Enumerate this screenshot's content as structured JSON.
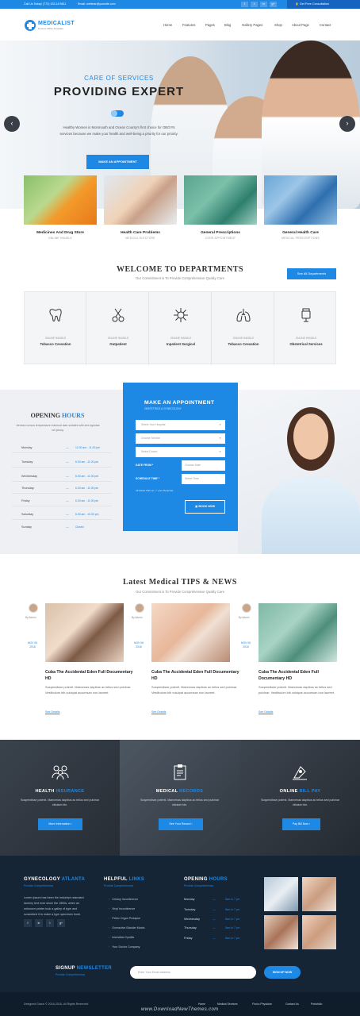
{
  "topbar": {
    "call": "Call Us Today! (772) 433-18 5611",
    "email": "Email: webinar@yoursite.com",
    "social": [
      "f",
      "t",
      "in",
      "g+"
    ],
    "consult": "Get Free Consultation"
  },
  "header": {
    "logo": "MEDICALIST",
    "tagline": "Doctors Office Template",
    "nav": [
      "Home",
      "Features",
      "Pages",
      "Blog",
      "Gallery Pages",
      "Shop",
      "About Page",
      "Contact"
    ]
  },
  "hero": {
    "eyebrow": "CARE OF SERVICES",
    "title": "PROVIDING EXPERT",
    "text": "Healthy Women is Monmouth and Ocean County's first choice for OBGYN services because we make your health and well-being a priority for our priority.",
    "button": "MAKE AN APPOINTMENT",
    "prev": "‹",
    "next": "›"
  },
  "features": [
    {
      "title": "Medicines And Drug Store",
      "sub": "ONLINE HANDLE"
    },
    {
      "title": "Health Care Problems",
      "sub": "MEDICAL ELECTORE"
    },
    {
      "title": "General Prescriptions",
      "sub": "CORE APPOINTMENT"
    },
    {
      "title": "General Health Care",
      "sub": "MEDICAL PRESCRIPTIONS"
    }
  ],
  "departments": {
    "title": "WELCOME TO DEPARTMENTS",
    "subtitle": "Our Commitment is To Provide Comprehensive Quality Care",
    "all_button": "See All Departments",
    "items": [
      {
        "label": "ONLINE HANDLE",
        "title": "Tobacco Cessation"
      },
      {
        "label": "ONLINE HANDLE",
        "title": "Outpatient"
      },
      {
        "label": "ONLINE HANDLE",
        "title": "Inpatient Surgical"
      },
      {
        "label": "ONLINE HANDLE",
        "title": "Tobacco Cessation"
      },
      {
        "label": "ONLINE HANDLE",
        "title": "Obstetrical Services"
      }
    ]
  },
  "hours": {
    "title_a": "OPENING ",
    "title_b": "HOURS",
    "desc": "Aenean cursus temperature euismod iaae sodales with sed egestas vel pecoy.",
    "rows": [
      {
        "day": "Monday",
        "time": "12.00 am - 11.00 pm"
      },
      {
        "day": "Tuesday",
        "time": "6.00 am - 11.00 pm"
      },
      {
        "day": "Wednesday",
        "time": "6.00 am - 11.00 pm"
      },
      {
        "day": "Thursday",
        "time": "6.00 am - 11.00 pm"
      },
      {
        "day": "Friday",
        "time": "6.00 am - 11.00 pm"
      },
      {
        "day": "Saturday",
        "time": "6.00 am - 10.00 pm"
      },
      {
        "day": "Sunday",
        "time": "Closed"
      }
    ]
  },
  "appointment": {
    "title": "MAKE AN APPOINTMENT",
    "subtitle": "OBSTETRICS & GYNECOLOGY",
    "select_dept": "Select Your Hospital",
    "select_service": "Choose Service",
    "select_doctor": "Select Doctor",
    "date_label": "DATE FROM *",
    "date_placeholder": "Choose Date",
    "time_label": "SCHEDULE TIME *",
    "time_placeholder": "Select Time",
    "note": "All Fields With an ( * ) Are Required.",
    "button": "BOOK NOW"
  },
  "news": {
    "title": "Latest Medical TIPS & NEWS",
    "subtitle": "Our Commitment is To Provide Comprehensive Quality Care",
    "posts": [
      {
        "by": "By Admin",
        "date": "NOV 06 2016",
        "title": "Cuba The Accidental Eden Full Documentary HD",
        "text": "Suspendisse potenti. Maecenas dapibus ac tellus sed pulvinar. Vestibulum bib volutpat accumsan non laoreet.",
        "more": "See Details"
      },
      {
        "by": "By Admin",
        "date": "NOV 06 2016",
        "title": "Cuba The Accidental Eden Full Documentary HD",
        "text": "Suspendisse potenti. Maecenas dapibus ac tellus sed pulvinar. Vestibulum bib volutpat accumsan non laoreet.",
        "more": "See Details"
      },
      {
        "by": "By Admin",
        "date": "NOV 06 2016",
        "title": "Cuba The Accidental Eden Full Documentary HD",
        "text": "Suspendisse potenti. Maecenas dapibus ac tellus sed pulvinar. Vestibulum bib volutpat accumsan non laoreet.",
        "more": "See Details"
      }
    ]
  },
  "services": [
    {
      "title_a": "HEALTH ",
      "title_b": "INSURANCE",
      "text": "Suspendisse potenti. Maecenas dapibus ac tellus sed pulvinar nibulum bin.",
      "button": "More Information"
    },
    {
      "title_a": "MEDICAL ",
      "title_b": "RECORDS",
      "text": "Suspendisse potenti. Maecenas dapibus ac tellus sed pulvinar nibulum bin.",
      "button": "See Your Record"
    },
    {
      "title_a": "ONLINE ",
      "title_b": "BILL PAY",
      "text": "Suspendisse potenti. Maecenas dapibus ac tellus sed pulvinar nibulum bin.",
      "button": "Pay Bill Now"
    }
  ],
  "footer": {
    "about_title_a": "GYNECOLOGY ",
    "about_title_b": "ATLANTA",
    "about_sub": "Provide Comprehensive",
    "about_text": "Lorem Ipsum has been the industry's standard dummy text ever since the 1500s, when an unknown printer took a galley of type and scrambled it to make a type specimen book.",
    "social": [
      "f",
      "in",
      "t",
      "g+"
    ],
    "links_title_a": "HELPFUL ",
    "links_title_b": "LINKS",
    "links_sub": "Provide Comprehensive",
    "links": [
      "Urinary Incontinence",
      "Vinyl Incontinence",
      "Pelvic Organ Prolapse",
      "Overactive Bladder Marks",
      "Interstitial Cystitis",
      "Your Doctor Company"
    ],
    "hours_title_a": "OPENING ",
    "hours_title_b": "HOURS",
    "hours_sub": "Provide Comprehensive",
    "hours": [
      {
        "day": "Monday",
        "time": "8am to 7 pm"
      },
      {
        "day": "Tuesday",
        "time": "8am to 7 pm"
      },
      {
        "day": "Wednesday",
        "time": "8am to 7 pm"
      },
      {
        "day": "Thursday",
        "time": "8am to 7 pm"
      },
      {
        "day": "Friday",
        "time": "8am to 7 pm"
      }
    ],
    "signup_title_a": "SIGNUP ",
    "signup_title_b": "NEWSLETTER",
    "signup_sub": "Provide Comprehensive",
    "email_placeholder": "Enter Your Email Address",
    "signup_button": "SIGN UP NOW",
    "copyright": "Designed Grace © 2016-2018, All Rights Reserved.",
    "bottom_nav": [
      "Home",
      "Medical Services",
      "Find a Physician",
      "Contact Us",
      "Portofolio"
    ],
    "watermark": "www.DownloadNewThemes.com"
  }
}
